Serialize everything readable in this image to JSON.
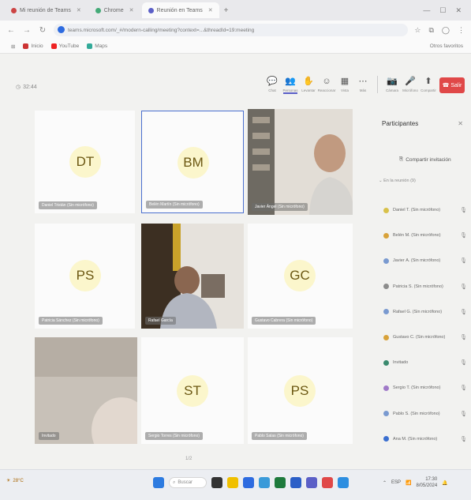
{
  "browser": {
    "tabs": [
      {
        "label": "Mi reunión de Teams",
        "color": "#c44",
        "active": false
      },
      {
        "label": "Chrome",
        "color": "#4a7",
        "active": false
      },
      {
        "label": "Reunión en Teams",
        "color": "#5b5fc7",
        "active": true
      }
    ],
    "url": "teams.microsoft.com/_#/modern-calling/meeting?context=...&threadId=19:meeting",
    "bookmarks": [
      {
        "label": "Inicio",
        "color": "#c33"
      },
      {
        "label": "YouTube",
        "color": "#e22"
      },
      {
        "label": "Maps",
        "color": "#3a9"
      }
    ],
    "bookmarks_right": "Otros favoritos"
  },
  "meeting": {
    "elapsed": "32:44",
    "tools": [
      {
        "icon": "💬",
        "label": "Chat"
      },
      {
        "icon": "👥",
        "label": "Personas"
      },
      {
        "icon": "✋",
        "label": "Levantar"
      },
      {
        "icon": "☺",
        "label": "Reaccionar"
      },
      {
        "icon": "▦",
        "label": "Vista"
      },
      {
        "icon": "⋯",
        "label": "Más"
      }
    ],
    "media": [
      {
        "icon": "📷",
        "label": "Cámara"
      },
      {
        "icon": "🎤",
        "label": "Micrófono"
      },
      {
        "icon": "⬆",
        "label": "Compartir"
      }
    ],
    "leave_label": "Salir",
    "page_indicator": "1/2"
  },
  "tiles": [
    {
      "initials": "DT",
      "name": "Daniel Tristán (Sin micrófono)",
      "video": false
    },
    {
      "initials": "BM",
      "name": "Belén Martín (Sin micrófono)",
      "video": false,
      "selected": true
    },
    {
      "initials": "",
      "name": "Javier Ángel (Sin micrófono)",
      "video": true,
      "tone": "#c9b49a"
    },
    {
      "initials": "PS",
      "name": "Patricia Sánchez (Sin micrófono)",
      "video": false
    },
    {
      "initials": "",
      "name": "Rafael García",
      "video": true,
      "tone": "#8a7460"
    },
    {
      "initials": "GC",
      "name": "Gustavo Cabrera (Sin micrófono)",
      "video": false
    },
    {
      "initials": "",
      "name": "Invitado",
      "video": true,
      "tone": "#b9a89a"
    },
    {
      "initials": "ST",
      "name": "Sergio Torres (Sin micrófono)",
      "video": false
    },
    {
      "initials": "PS",
      "name": "Pablo Salas (Sin micrófono)",
      "video": false
    }
  ],
  "participants": {
    "title": "Participantes",
    "share_label": "Compartir invitación",
    "section_label": "En la reunión (9)",
    "items": [
      {
        "name": "Daniel T. (Sin micrófono)",
        "color": "#d8c14a"
      },
      {
        "name": "Belén M. (Sin micrófono)",
        "color": "#d8a23a"
      },
      {
        "name": "Javier Á. (Sin micrófono)",
        "color": "#7a9ad0"
      },
      {
        "name": "Patricia S. (Sin micrófono)",
        "color": "#8c8c8c"
      },
      {
        "name": "Rafael G. (Sin micrófono)",
        "color": "#7a9ad0"
      },
      {
        "name": "Gustavo C. (Sin micrófono)",
        "color": "#d8a23a"
      },
      {
        "name": "Invitado",
        "color": "#3b8a6e"
      },
      {
        "name": "Sergio T. (Sin micrófono)",
        "color": "#a07ac8"
      },
      {
        "name": "Pablo S. (Sin micrófono)",
        "color": "#7a9ad0"
      },
      {
        "name": "Ana M. (Sin micrófono)",
        "color": "#3b6fd0"
      }
    ]
  },
  "taskbar": {
    "weather": "28°C",
    "search_label": "Buscar",
    "apps": [
      {
        "color": "#333"
      },
      {
        "color": "#f0c000"
      },
      {
        "color": "#2d6be0"
      },
      {
        "color": "#3a9ad9"
      },
      {
        "color": "#1e7a3c"
      },
      {
        "color": "#2b5ec7"
      },
      {
        "color": "#5b5fc7"
      },
      {
        "color": "#e04848"
      },
      {
        "color": "#2d8ee0"
      }
    ],
    "lang": "ESP",
    "time": "17:30",
    "date": "8/05/2024"
  }
}
